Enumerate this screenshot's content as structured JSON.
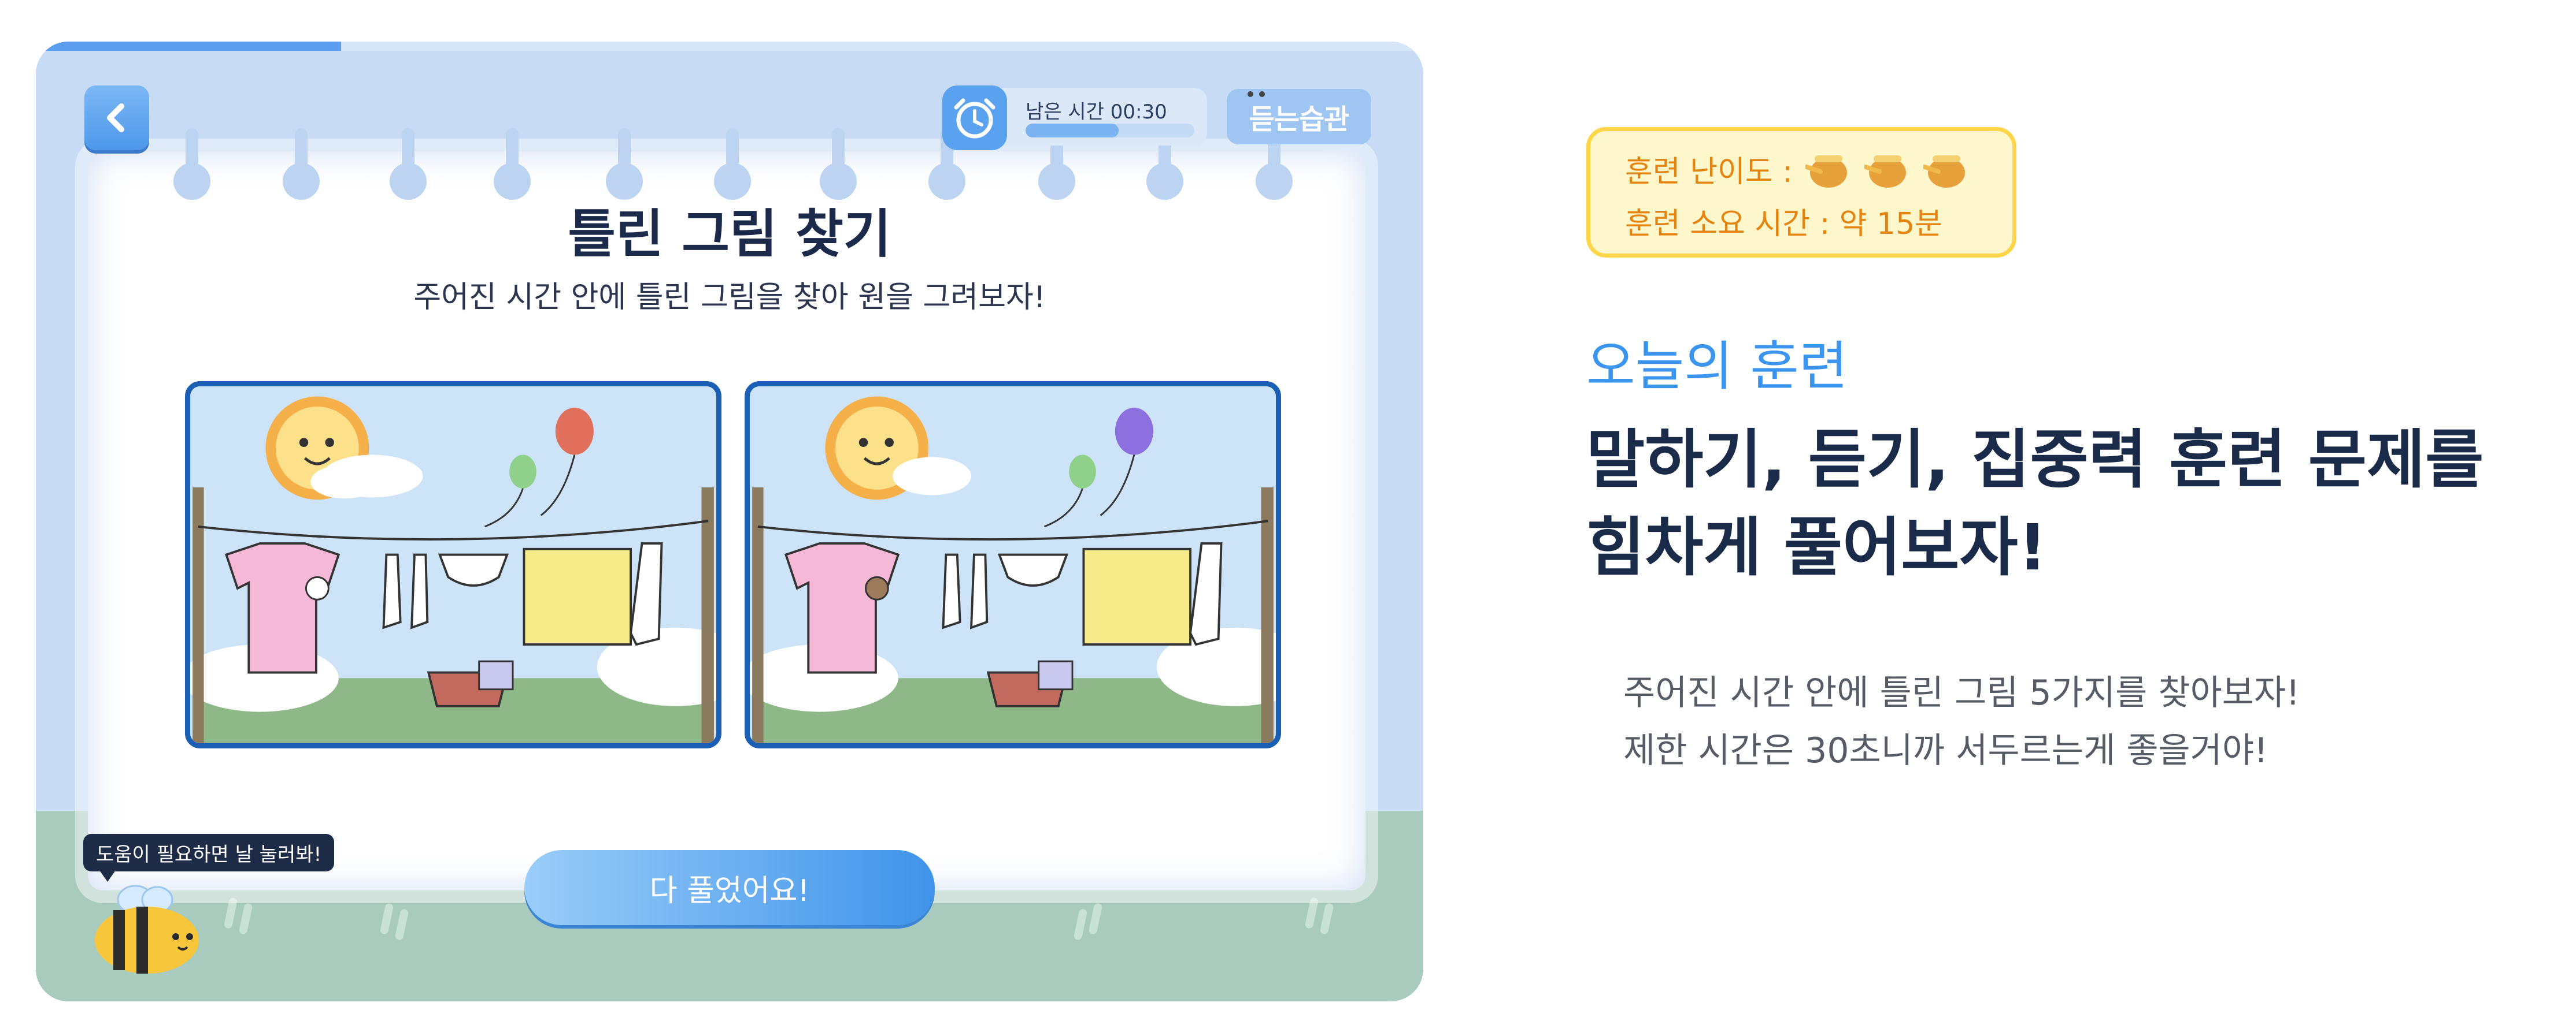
{
  "header": {
    "timer_label": "남은 시간 00:30",
    "timer_progress": 0.55,
    "logo_text": "듣는습관"
  },
  "screen_progress": 0.22,
  "game": {
    "title": "틀린 그림 찾기",
    "subtitle": "주어진 시간 안에 틀린 그림을 찾아 원을 그려보자!",
    "balloon_color_left": "#e0705c",
    "balloon_color_right": "#8e6fe0",
    "shirt_patch_left": "rabbit",
    "shirt_patch_right": "bear"
  },
  "help": {
    "bubble_text": "도움이 필요하면 날 눌러봐!"
  },
  "done_button": {
    "label": "다 풀었어요!"
  },
  "info": {
    "difficulty_label": "훈련 난이도 :",
    "difficulty_level": 3,
    "time_label": "훈련 소요 시간 : 약 15분"
  },
  "today": {
    "label": "오늘의 훈련",
    "headline_line1": "말하기, 듣기, 집중력 훈련 문제를",
    "headline_line2": "힘차게 풀어보자!",
    "desc_line1": "주어진 시간 안에 틀린 그림 5가지를 찾아보자!",
    "desc_line2": "제한 시간은 30초니까 서두르는게 좋을거야!"
  },
  "colors": {
    "accent_blue": "#3b94ee",
    "panel_bg": "#c7dbf5",
    "badge_yellow": "#ffd54a",
    "badge_text_orange": "#e4830e"
  }
}
